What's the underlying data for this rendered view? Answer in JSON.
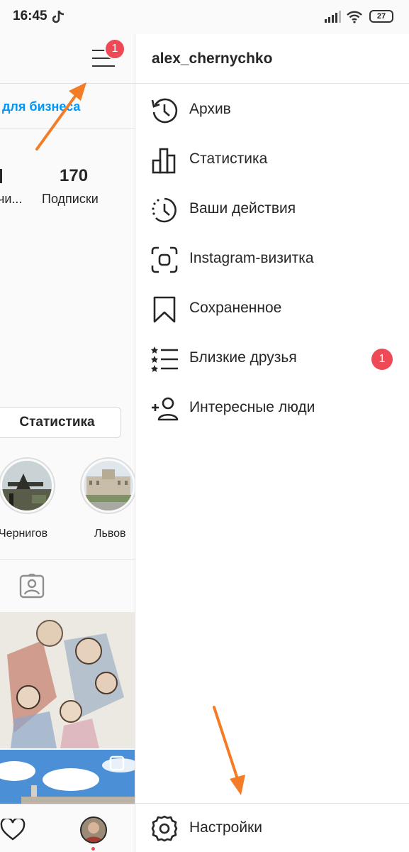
{
  "status_bar": {
    "time": "16:45",
    "battery": "27",
    "icons": [
      "tiktok-icon",
      "signal-icon",
      "wifi-icon",
      "battery-icon"
    ]
  },
  "profile": {
    "notification_count": "1",
    "business_link": "для бизнеса",
    "stats": [
      {
        "value": "",
        "label": "чи..."
      },
      {
        "value": "170",
        "label": "Подписки"
      }
    ],
    "stats_button": "Статистика",
    "highlights": [
      {
        "label": "Чернигов"
      },
      {
        "label": "Львов"
      }
    ]
  },
  "drawer": {
    "username": "alex_chernychko",
    "items": [
      {
        "label": "Архив",
        "icon": "archive-history-icon"
      },
      {
        "label": "Статистика",
        "icon": "bar-chart-icon"
      },
      {
        "label": "Ваши действия",
        "icon": "activity-clock-icon"
      },
      {
        "label": "Instagram-визитка",
        "icon": "nametag-icon"
      },
      {
        "label": "Сохраненное",
        "icon": "bookmark-icon"
      },
      {
        "label": "Близкие друзья",
        "icon": "close-friends-list-icon",
        "badge": "1"
      },
      {
        "label": "Интересные люди",
        "icon": "add-person-icon"
      }
    ],
    "settings_label": "Настройки"
  },
  "colors": {
    "badge": "#ed4956",
    "link": "#0095f6",
    "annotation_arrow": "#f57c26"
  }
}
